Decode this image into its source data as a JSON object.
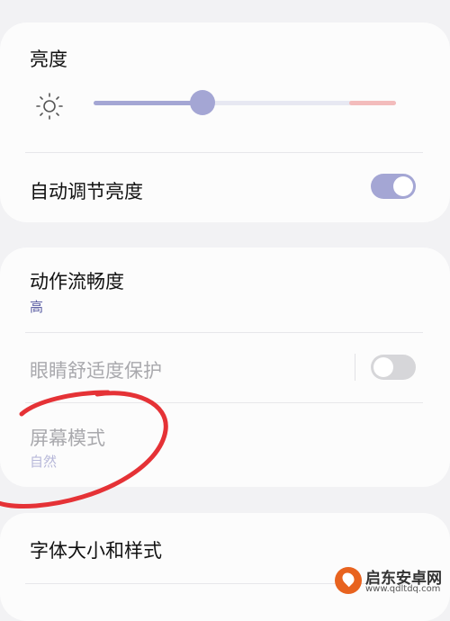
{
  "brightness": {
    "title": "亮度",
    "level_percent": 36
  },
  "auto_brightness": {
    "label": "自动调节亮度",
    "enabled": true
  },
  "motion_smoothness": {
    "label": "动作流畅度",
    "value": "高"
  },
  "eye_comfort": {
    "label": "眼睛舒适度保护",
    "enabled": false
  },
  "screen_mode": {
    "label": "屏幕模式",
    "value": "自然"
  },
  "font_size_style": {
    "label": "字体大小和样式"
  },
  "watermark": {
    "name": "启东安卓网",
    "url": "www.qdltdq.com"
  },
  "colors": {
    "accent": "#a4a6d4",
    "annotation_red": "#e53236",
    "warning_zone": "#f3bcbc"
  }
}
